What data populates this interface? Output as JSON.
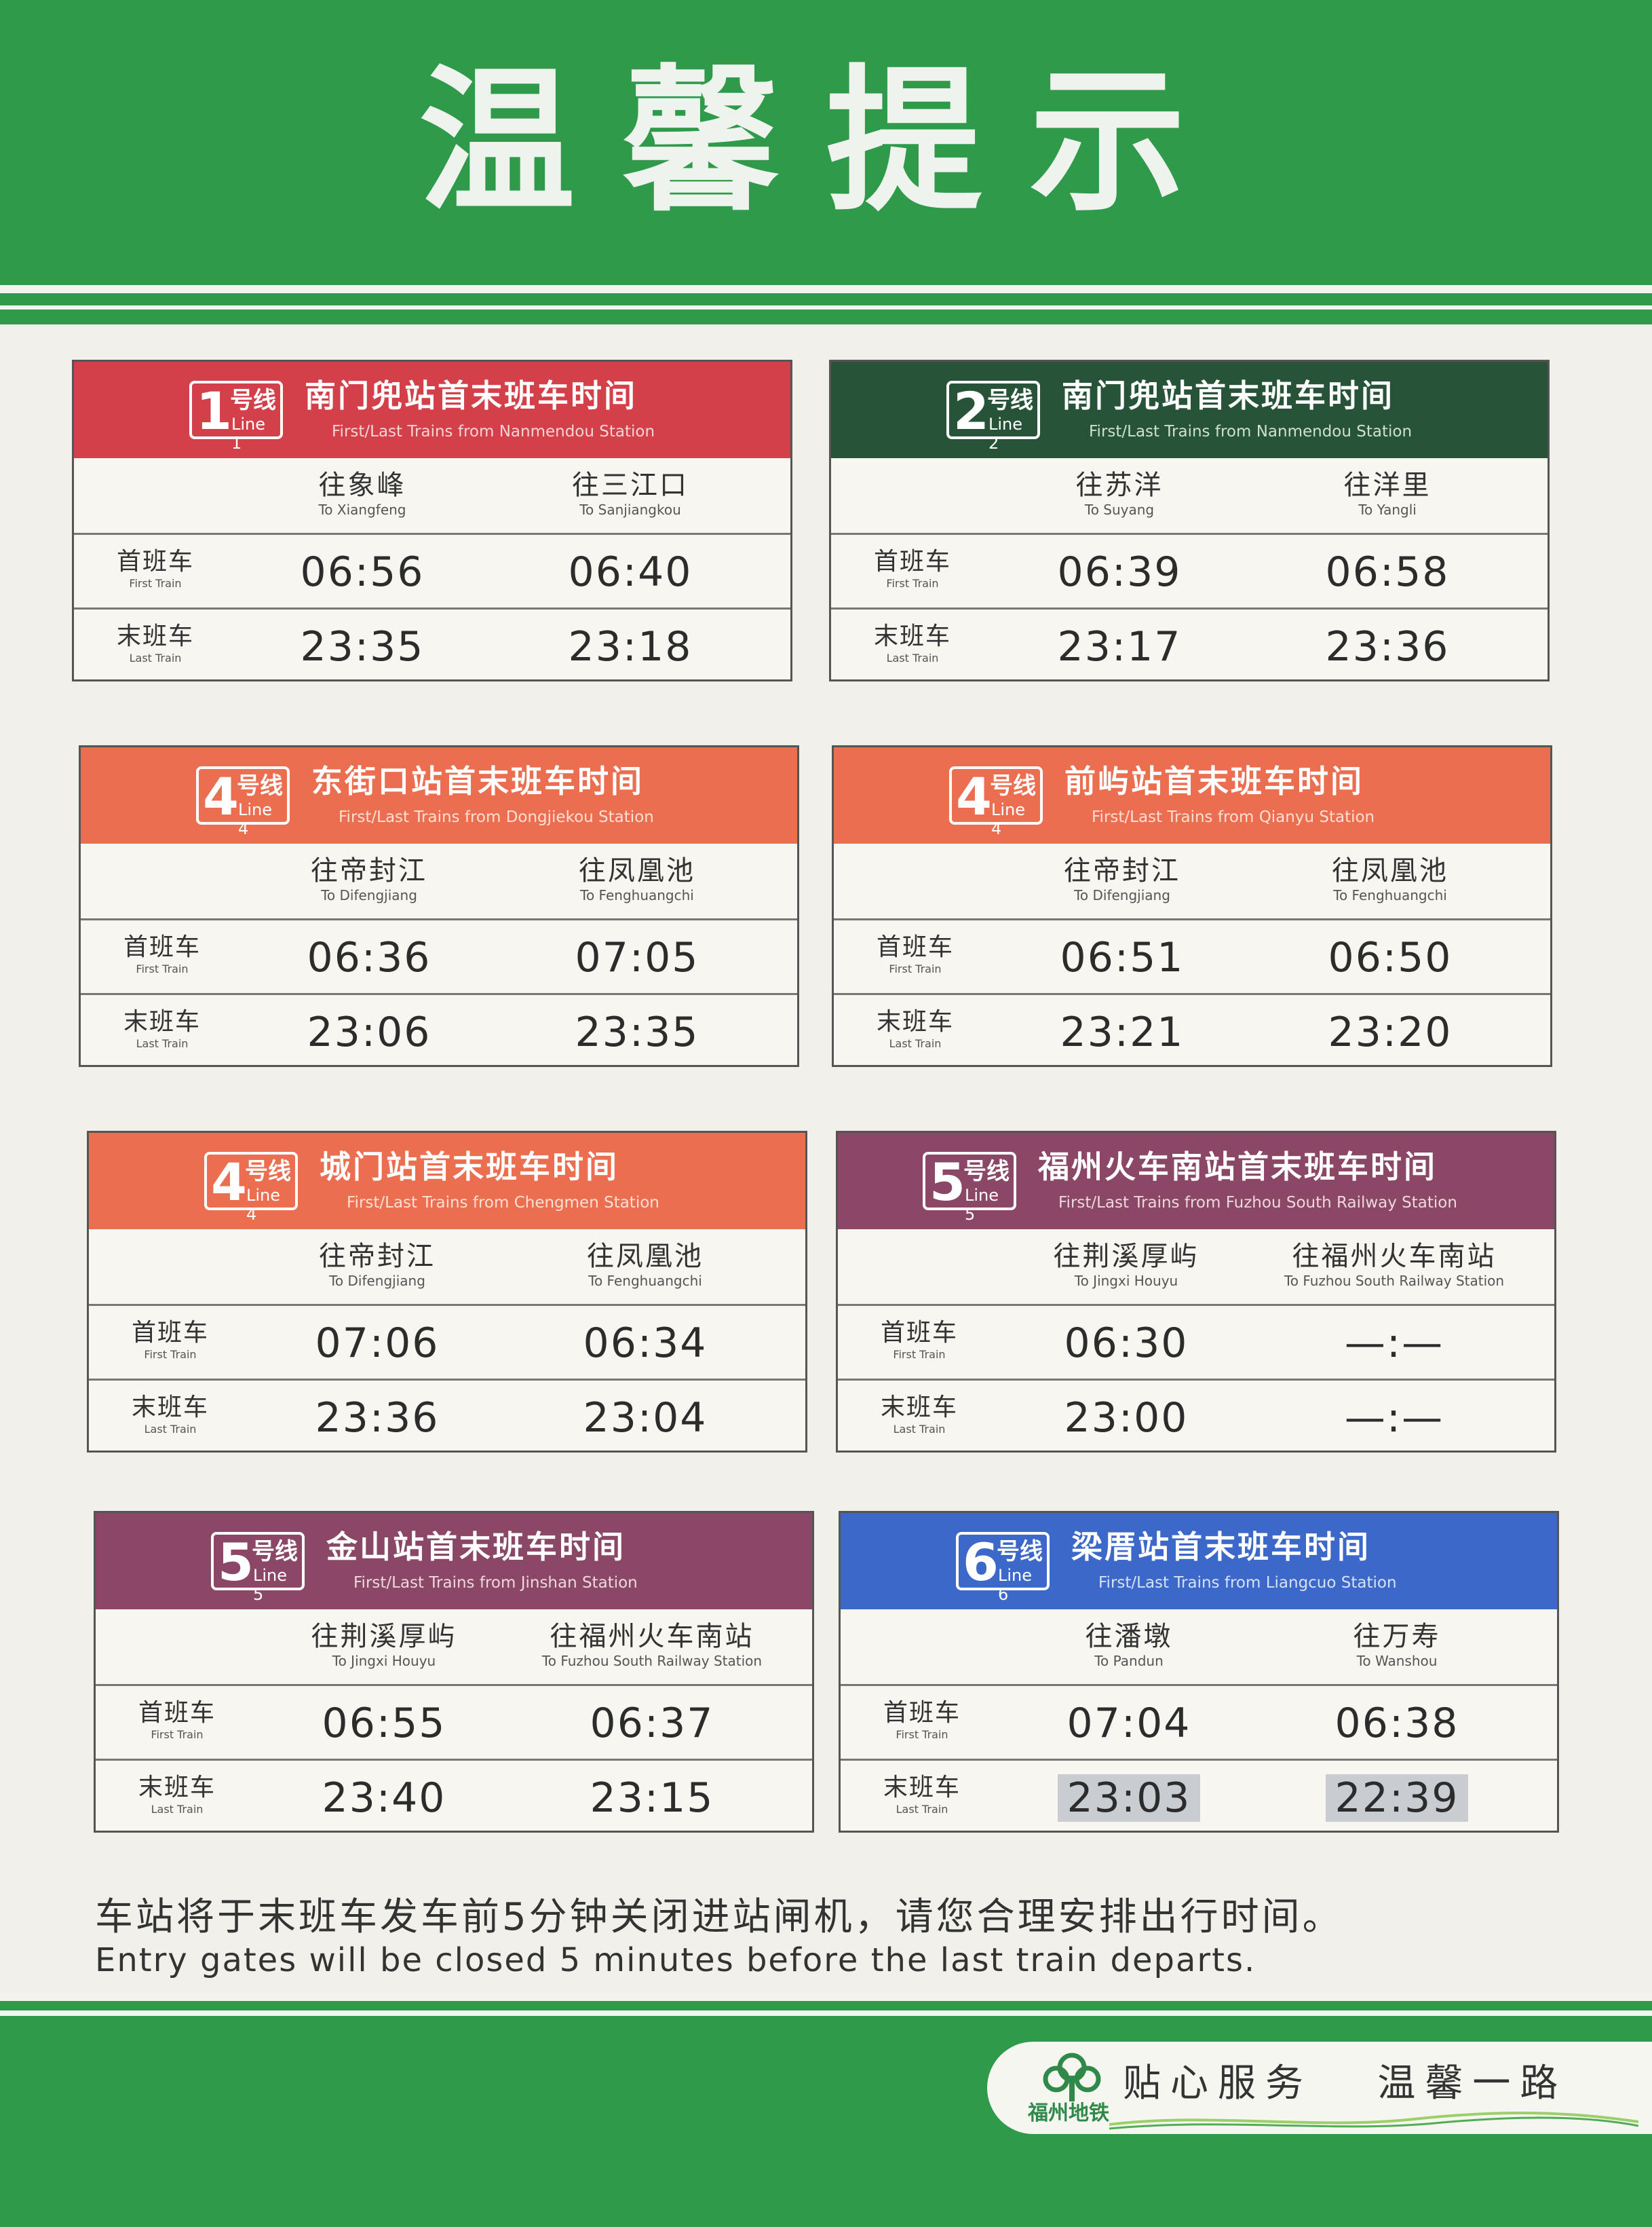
{
  "header": {
    "title": "温馨提示"
  },
  "panels": [
    {
      "line_num": "1",
      "line_cn": "号线",
      "line_en": "Line 1",
      "title": "南门兜站首末班车时间",
      "subtitle": "First/Last Trains from Nanmendou Station",
      "dest1_cn": "往象峰",
      "dest1_en": "To Xiangfeng",
      "dest2_cn": "往三江口",
      "dest2_en": "To Sanjiangkou",
      "first_cn": "首班车",
      "first_en": "First Train",
      "last_cn": "末班车",
      "last_en": "Last Train",
      "first1": "06:56",
      "first2": "06:40",
      "last1": "23:35",
      "last2": "23:18"
    },
    {
      "line_num": "2",
      "line_cn": "号线",
      "line_en": "Line 2",
      "title": "南门兜站首末班车时间",
      "subtitle": "First/Last Trains from Nanmendou Station",
      "dest1_cn": "往苏洋",
      "dest1_en": "To Suyang",
      "dest2_cn": "往洋里",
      "dest2_en": "To Yangli",
      "first_cn": "首班车",
      "first_en": "First Train",
      "last_cn": "末班车",
      "last_en": "Last Train",
      "first1": "06:39",
      "first2": "06:58",
      "last1": "23:17",
      "last2": "23:36"
    },
    {
      "line_num": "4",
      "line_cn": "号线",
      "line_en": "Line 4",
      "title": "东街口站首末班车时间",
      "subtitle": "First/Last Trains from Dongjiekou Station",
      "dest1_cn": "往帝封江",
      "dest1_en": "To Difengjiang",
      "dest2_cn": "往凤凰池",
      "dest2_en": "To Fenghuangchi",
      "first_cn": "首班车",
      "first_en": "First Train",
      "last_cn": "末班车",
      "last_en": "Last Train",
      "first1": "06:36",
      "first2": "07:05",
      "last1": "23:06",
      "last2": "23:35"
    },
    {
      "line_num": "4",
      "line_cn": "号线",
      "line_en": "Line 4",
      "title": "前屿站首末班车时间",
      "subtitle": "First/Last Trains from Qianyu Station",
      "dest1_cn": "往帝封江",
      "dest1_en": "To Difengjiang",
      "dest2_cn": "往凤凰池",
      "dest2_en": "To Fenghuangchi",
      "first_cn": "首班车",
      "first_en": "First Train",
      "last_cn": "末班车",
      "last_en": "Last Train",
      "first1": "06:51",
      "first2": "06:50",
      "last1": "23:21",
      "last2": "23:20"
    },
    {
      "line_num": "4",
      "line_cn": "号线",
      "line_en": "Line 4",
      "title": "城门站首末班车时间",
      "subtitle": "First/Last Trains from Chengmen Station",
      "dest1_cn": "往帝封江",
      "dest1_en": "To Difengjiang",
      "dest2_cn": "往凤凰池",
      "dest2_en": "To Fenghuangchi",
      "first_cn": "首班车",
      "first_en": "First Train",
      "last_cn": "末班车",
      "last_en": "Last Train",
      "first1": "07:06",
      "first2": "06:34",
      "last1": "23:36",
      "last2": "23:04"
    },
    {
      "line_num": "5",
      "line_cn": "号线",
      "line_en": "Line 5",
      "title": "福州火车南站首末班车时间",
      "subtitle": "First/Last Trains from Fuzhou South Railway Station",
      "dest1_cn": "往荆溪厚屿",
      "dest1_en": "To Jingxi Houyu",
      "dest2_cn": "往福州火车南站",
      "dest2_en": "To Fuzhou South Railway Station",
      "first_cn": "首班车",
      "first_en": "First Train",
      "last_cn": "末班车",
      "last_en": "Last Train",
      "first1": "06:30",
      "first2": "—:—",
      "last1": "23:00",
      "last2": "—:—"
    },
    {
      "line_num": "5",
      "line_cn": "号线",
      "line_en": "Line 5",
      "title": "金山站首末班车时间",
      "subtitle": "First/Last Trains from Jinshan Station",
      "dest1_cn": "往荆溪厚屿",
      "dest1_en": "To Jingxi Houyu",
      "dest2_cn": "往福州火车南站",
      "dest2_en": "To Fuzhou South Railway Station",
      "first_cn": "首班车",
      "first_en": "First Train",
      "last_cn": "末班车",
      "last_en": "Last Train",
      "first1": "06:55",
      "first2": "06:37",
      "last1": "23:40",
      "last2": "23:15"
    },
    {
      "line_num": "6",
      "line_cn": "号线",
      "line_en": "Line 6",
      "title": "梁厝站首末班车时间",
      "subtitle": "First/Last Trains from Liangcuo Station",
      "dest1_cn": "往潘墩",
      "dest1_en": "To Pandun",
      "dest2_cn": "往万寿",
      "dest2_en": "To Wanshou",
      "first_cn": "首班车",
      "first_en": "First Train",
      "last_cn": "末班车",
      "last_en": "Last Train",
      "first1": "07:04",
      "first2": "06:38",
      "last1": "23:03",
      "last2": "22:39"
    }
  ],
  "notice": {
    "cn": "车站将于末班车发车前5分钟关闭进站闸机，请您合理安排出行时间。",
    "en": "Entry gates will be closed 5 minutes before the last train departs."
  },
  "footer": {
    "logo_text": "福州地铁",
    "slogan": "贴心服务   温馨一路"
  },
  "colors": {
    "brand_green": "#2e9a4a",
    "line1": "#d4404a",
    "line2": "#275438",
    "line4": "#ec6e51",
    "line5": "#8a4866",
    "line6": "#3c68c9"
  }
}
